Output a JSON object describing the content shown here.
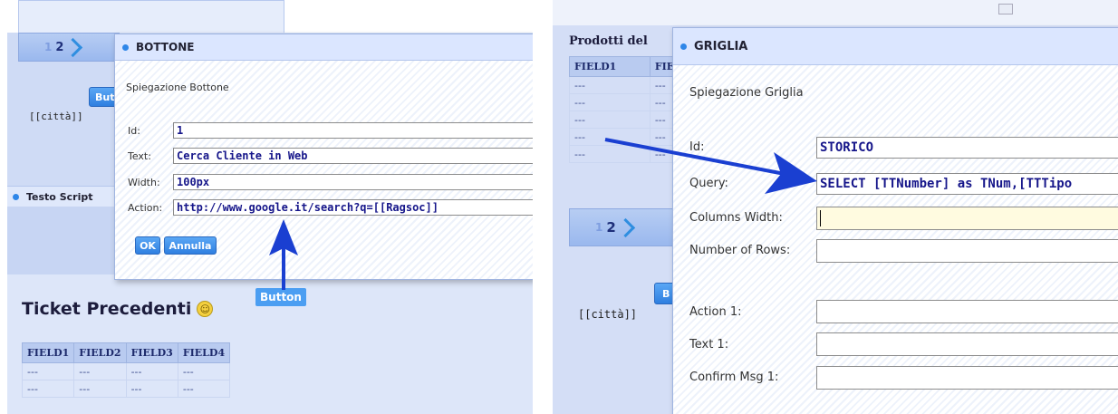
{
  "left": {
    "pager": {
      "prev": "1",
      "current": "2"
    },
    "button_label_partial": "Butt",
    "citta": "[[città]]",
    "section_testo": "Testo Script",
    "ticket_title": "Ticket Precedenti",
    "grid": {
      "columns": [
        "FIELD1",
        "FIELD2",
        "FIELD3",
        "FIELD4"
      ],
      "rows": [
        [
          "---",
          "---",
          "---",
          "---"
        ],
        [
          "---",
          "---",
          "---",
          "---"
        ]
      ]
    },
    "dialog": {
      "title": "BOTTONE",
      "description": "Spiegazione Bottone",
      "id_label": "Id:",
      "id_value": "1",
      "text_label": "Text:",
      "text_value": "Cerca Cliente in Web",
      "width_label": "Width:",
      "width_value": "100px",
      "action_label": "Action:",
      "action_value": "http://www.google.it/search?q=[[Ragsoc]]",
      "ok_label": "OK",
      "cancel_label": "Annulla"
    },
    "callout_button": "Button"
  },
  "right": {
    "panel_title": "Prodotti del",
    "grid": {
      "columns": [
        "FIELD1",
        "FIE"
      ],
      "rows": [
        [
          "---",
          "---"
        ],
        [
          "---",
          "---"
        ],
        [
          "---",
          "---"
        ],
        [
          "---",
          "---"
        ],
        [
          "---",
          "---"
        ]
      ]
    },
    "pager": {
      "prev": "1",
      "current": "2"
    },
    "button_label_partial": "B",
    "citta": "[[città]]",
    "dialog": {
      "title": "GRIGLIA",
      "description": "Spiegazione Griglia",
      "id_label": "Id:",
      "id_value": "STORICO",
      "query_label": "Query:",
      "query_value": "SELECT [TTNumber] as TNum,[TTTipo",
      "colwidth_label": "Columns Width:",
      "colwidth_value": "",
      "numrows_label": "Number of Rows:",
      "numrows_value": "",
      "action1_label": "Action 1:",
      "action1_value": "",
      "text1_label": "Text 1:",
      "text1_value": "",
      "confirm1_label": "Confirm Msg 1:",
      "confirm1_value": ""
    }
  },
  "colors": {
    "accent": "#2e86e8",
    "arrow": "#1a3fd1"
  }
}
